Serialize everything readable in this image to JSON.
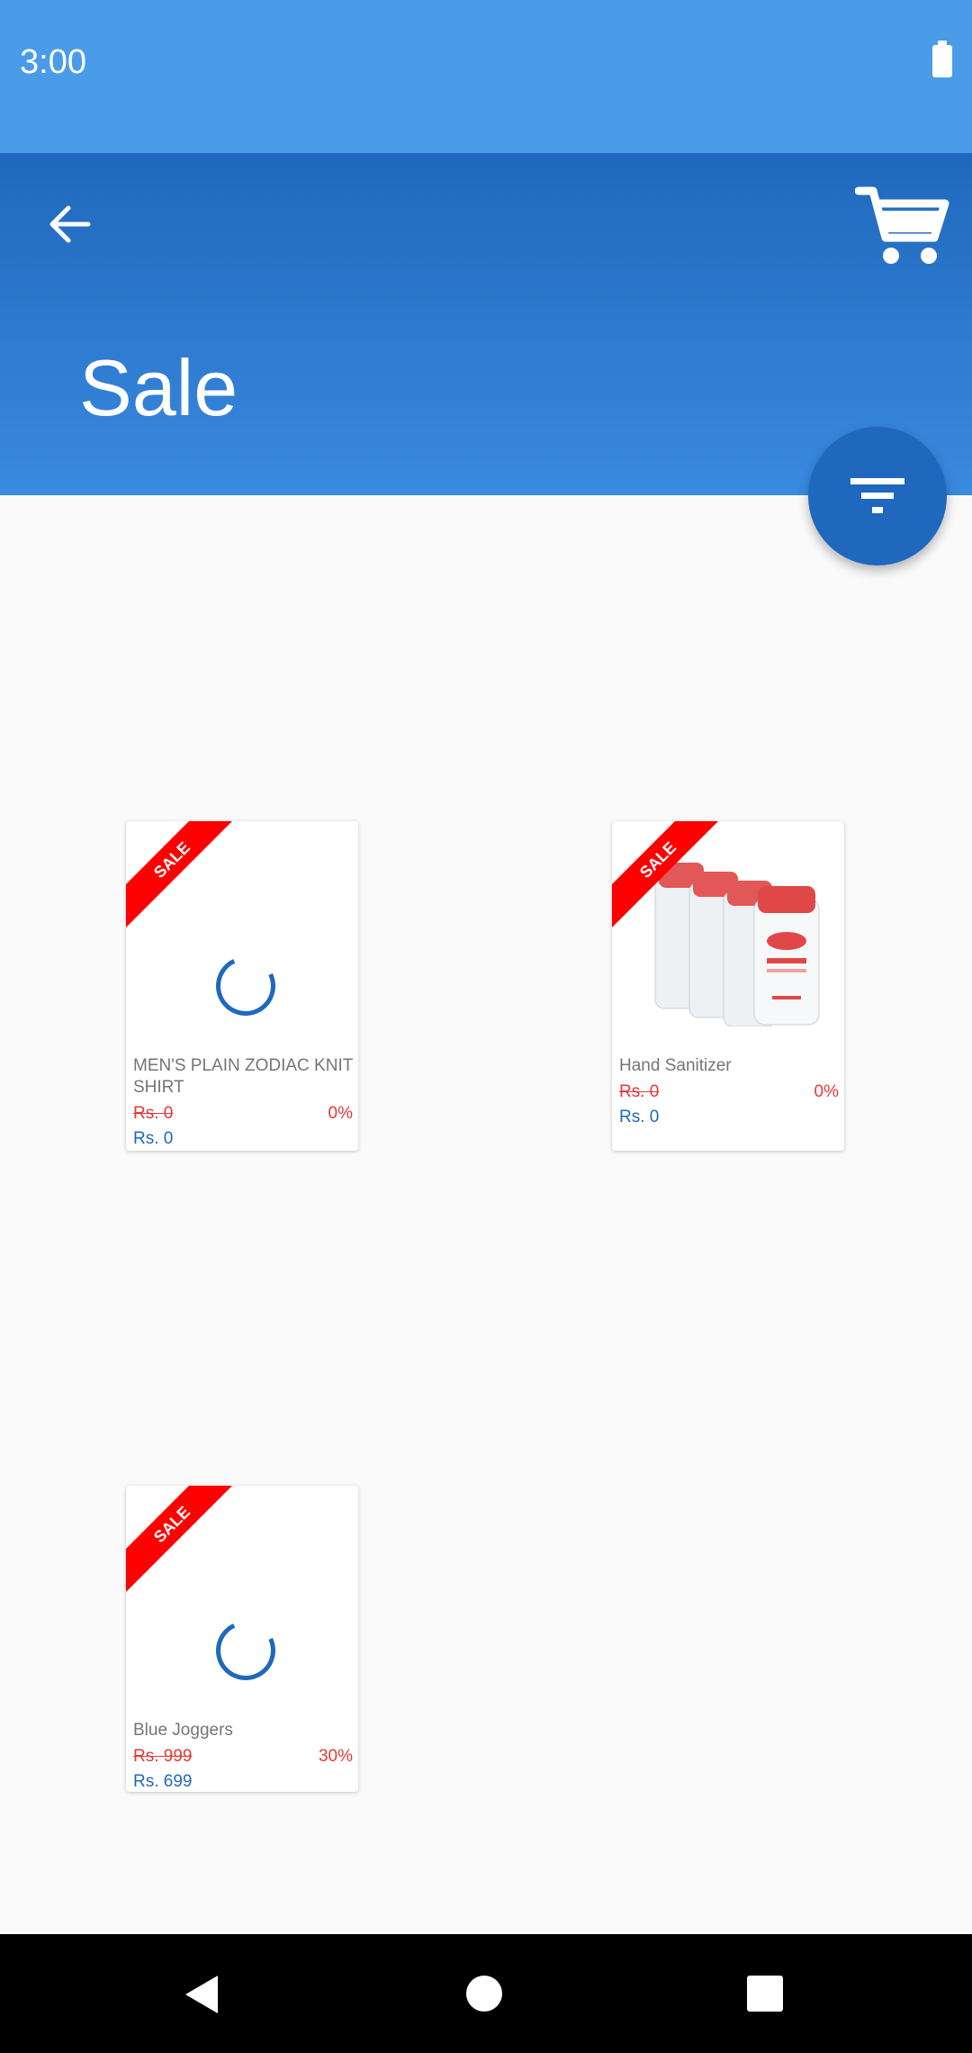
{
  "status_bar": {
    "time": "3:00"
  },
  "app_bar": {
    "title": "Sale"
  },
  "products": [
    {
      "name": "MEN'S PLAIN ZODIAC KNIT SHIRT",
      "badge": "SALE",
      "original_price": "Rs. 0",
      "discount": "0%",
      "price": "Rs. 0",
      "image": "loading-spinner"
    },
    {
      "name": "Hand Sanitizer",
      "badge": "SALE",
      "original_price": "Rs. 0",
      "discount": "0%",
      "price": "Rs. 0",
      "image": "sanitizer-bottles"
    },
    {
      "name": "Blue Joggers",
      "badge": "SALE",
      "original_price": "Rs. 999",
      "discount": "30%",
      "price": "Rs. 699",
      "image": "loading-spinner"
    }
  ],
  "colors": {
    "status_bar": "#4a9ce8",
    "app_bar_top": "#1f68bd",
    "app_bar_bottom": "#3a8ae0",
    "accent": "#1f68bd",
    "sale": "#ff0000"
  },
  "icons": {
    "back": "arrow-back-icon",
    "cart": "cart-icon",
    "filter": "filter-icon"
  }
}
